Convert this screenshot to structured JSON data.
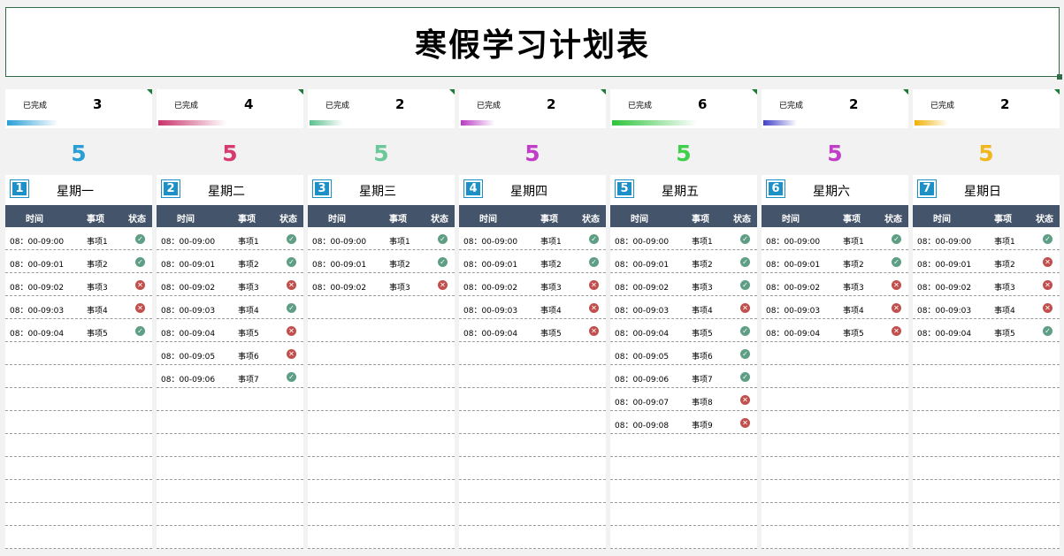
{
  "title": "寒假学习计划表",
  "labels": {
    "completed": "已完成",
    "col_time": "时间",
    "col_item": "事项",
    "col_status": "状态"
  },
  "status_icons": {
    "done": "check-icon",
    "not_done": "cross-icon"
  },
  "days": [
    {
      "index": "1",
      "name": "星期一",
      "completed": "3",
      "total": "5",
      "color": "#2a9fd6",
      "bar_start": "#2a9fd6",
      "rows": [
        {
          "time": "08：00-09:00",
          "item": "事项1",
          "done": true
        },
        {
          "time": "08：00-09:01",
          "item": "事项2",
          "done": true
        },
        {
          "time": "08：00-09:02",
          "item": "事项3",
          "done": false
        },
        {
          "time": "08：00-09:03",
          "item": "事项4",
          "done": false
        },
        {
          "time": "08：00-09:04",
          "item": "事项5",
          "done": true
        }
      ]
    },
    {
      "index": "2",
      "name": "星期二",
      "completed": "4",
      "total": "5",
      "color": "#d63a6e",
      "bar_start": "#c8336a",
      "rows": [
        {
          "time": "08：00-09:00",
          "item": "事项1",
          "done": true
        },
        {
          "time": "08：00-09:01",
          "item": "事项2",
          "done": true
        },
        {
          "time": "08：00-09:02",
          "item": "事项3",
          "done": false
        },
        {
          "time": "08：00-09:03",
          "item": "事项4",
          "done": true
        },
        {
          "time": "08：00-09:04",
          "item": "事项5",
          "done": false
        },
        {
          "time": "08：00-09:05",
          "item": "事项6",
          "done": false
        },
        {
          "time": "08：00-09:06",
          "item": "事项7",
          "done": true
        }
      ]
    },
    {
      "index": "3",
      "name": "星期三",
      "completed": "2",
      "total": "5",
      "color": "#6cc79b",
      "bar_start": "#5cbf8e",
      "rows": [
        {
          "time": "08：00-09:00",
          "item": "事项1",
          "done": true
        },
        {
          "time": "08：00-09:01",
          "item": "事项2",
          "done": true
        },
        {
          "time": "08：00-09:02",
          "item": "事项3",
          "done": false
        }
      ]
    },
    {
      "index": "4",
      "name": "星期四",
      "completed": "2",
      "total": "5",
      "color": "#c03ec8",
      "bar_start": "#b83ac4",
      "rows": [
        {
          "time": "08：00-09:00",
          "item": "事项1",
          "done": true
        },
        {
          "time": "08：00-09:01",
          "item": "事项2",
          "done": true
        },
        {
          "time": "08：00-09:02",
          "item": "事项3",
          "done": false
        },
        {
          "time": "08：00-09:03",
          "item": "事项4",
          "done": false
        },
        {
          "time": "08：00-09:04",
          "item": "事项5",
          "done": false
        }
      ]
    },
    {
      "index": "5",
      "name": "星期五",
      "completed": "6",
      "total": "5",
      "color": "#3fcf4a",
      "bar_start": "#2ec43c",
      "rows": [
        {
          "time": "08：00-09:00",
          "item": "事项1",
          "done": true
        },
        {
          "time": "08：00-09:01",
          "item": "事项2",
          "done": true
        },
        {
          "time": "08：00-09:02",
          "item": "事项3",
          "done": true
        },
        {
          "time": "08：00-09:03",
          "item": "事项4",
          "done": false
        },
        {
          "time": "08：00-09:04",
          "item": "事项5",
          "done": true
        },
        {
          "time": "08：00-09:05",
          "item": "事项6",
          "done": true
        },
        {
          "time": "08：00-09:06",
          "item": "事项7",
          "done": true
        },
        {
          "time": "08：00-09:07",
          "item": "事项8",
          "done": false
        },
        {
          "time": "08：00-09:08",
          "item": "事项9",
          "done": false
        }
      ]
    },
    {
      "index": "6",
      "name": "星期六",
      "completed": "2",
      "total": "5",
      "color": "#c03ec8",
      "bar_start": "#4040c8",
      "rows": [
        {
          "time": "08：00-09:00",
          "item": "事项1",
          "done": true
        },
        {
          "time": "08：00-09:01",
          "item": "事项2",
          "done": true
        },
        {
          "time": "08：00-09:02",
          "item": "事项3",
          "done": false
        },
        {
          "time": "08：00-09:03",
          "item": "事项4",
          "done": false
        },
        {
          "time": "08：00-09:04",
          "item": "事项5",
          "done": false
        }
      ]
    },
    {
      "index": "7",
      "name": "星期日",
      "completed": "2",
      "total": "5",
      "color": "#f0b81e",
      "bar_start": "#f0b000",
      "rows": [
        {
          "time": "08：00-09:00",
          "item": "事项1",
          "done": true
        },
        {
          "time": "08：00-09:01",
          "item": "事项2",
          "done": false
        },
        {
          "time": "08：00-09:02",
          "item": "事项3",
          "done": false
        },
        {
          "time": "08：00-09:03",
          "item": "事项4",
          "done": false
        },
        {
          "time": "08：00-09:04",
          "item": "事项5",
          "done": true
        }
      ]
    }
  ]
}
